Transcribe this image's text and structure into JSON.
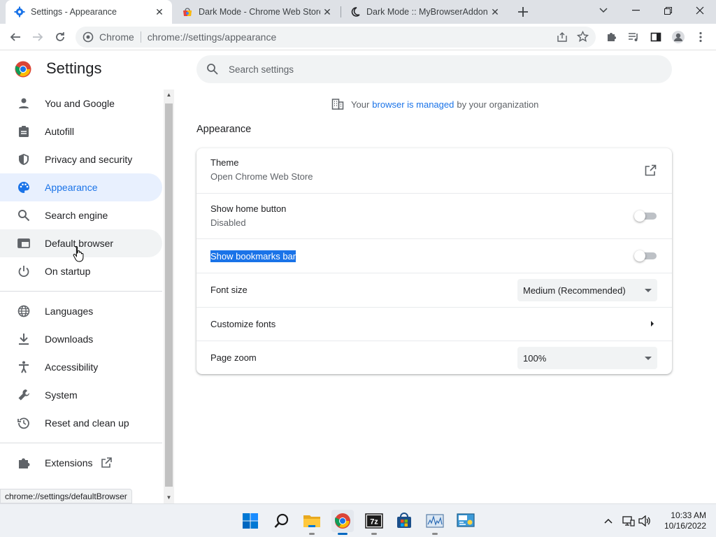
{
  "browser": {
    "tabs": [
      {
        "title": "Settings - Appearance",
        "icon": "gear-icon"
      },
      {
        "title": "Dark Mode - Chrome Web Store",
        "icon": "webstore-icon"
      },
      {
        "title": "Dark Mode :: MyBrowserAddon",
        "icon": "moon-icon"
      }
    ],
    "omnibox": {
      "site_label": "Chrome",
      "url": "chrome://settings/appearance"
    }
  },
  "settings": {
    "title": "Settings",
    "search_placeholder": "Search settings",
    "managed_notice": {
      "prefix": "Your",
      "link": "browser is managed",
      "suffix": "by your organization"
    },
    "sidebar": {
      "items": [
        {
          "label": "You and Google",
          "icon": "person-icon"
        },
        {
          "label": "Autofill",
          "icon": "clipboard-icon"
        },
        {
          "label": "Privacy and security",
          "icon": "shield-icon"
        },
        {
          "label": "Appearance",
          "icon": "palette-icon",
          "active": true
        },
        {
          "label": "Search engine",
          "icon": "search-icon"
        },
        {
          "label": "Default browser",
          "icon": "browser-window-icon",
          "hover": true
        },
        {
          "label": "On startup",
          "icon": "power-icon"
        },
        {
          "label": "Languages",
          "icon": "globe-icon"
        },
        {
          "label": "Downloads",
          "icon": "download-icon"
        },
        {
          "label": "Accessibility",
          "icon": "accessibility-icon"
        },
        {
          "label": "System",
          "icon": "wrench-icon"
        },
        {
          "label": "Reset and clean up",
          "icon": "history-icon"
        },
        {
          "label": "Extensions",
          "icon": "puzzle-icon"
        }
      ]
    },
    "appearance": {
      "section_title": "Appearance",
      "theme": {
        "label": "Theme",
        "sub": "Open Chrome Web Store"
      },
      "home_button": {
        "label": "Show home button",
        "sub": "Disabled",
        "enabled": false
      },
      "bookmarks_bar": {
        "label": "Show bookmarks bar",
        "enabled": false
      },
      "font_size": {
        "label": "Font size",
        "value": "Medium (Recommended)"
      },
      "customize_fonts": {
        "label": "Customize fonts"
      },
      "page_zoom": {
        "label": "Page zoom",
        "value": "100%"
      }
    }
  },
  "status_url": "chrome://settings/defaultBrowser",
  "taskbar": {
    "clock_time": "10:33 AM",
    "clock_date": "10/16/2022",
    "apps": [
      "windows-start-icon",
      "search-icon",
      "file-explorer-icon",
      "chrome-icon",
      "7zip-icon",
      "store-icon",
      "monitor-app-icon",
      "control-panel-icon"
    ]
  },
  "colors": {
    "accent": "#1a73e8",
    "active_nav_bg": "#e8f0fe"
  }
}
